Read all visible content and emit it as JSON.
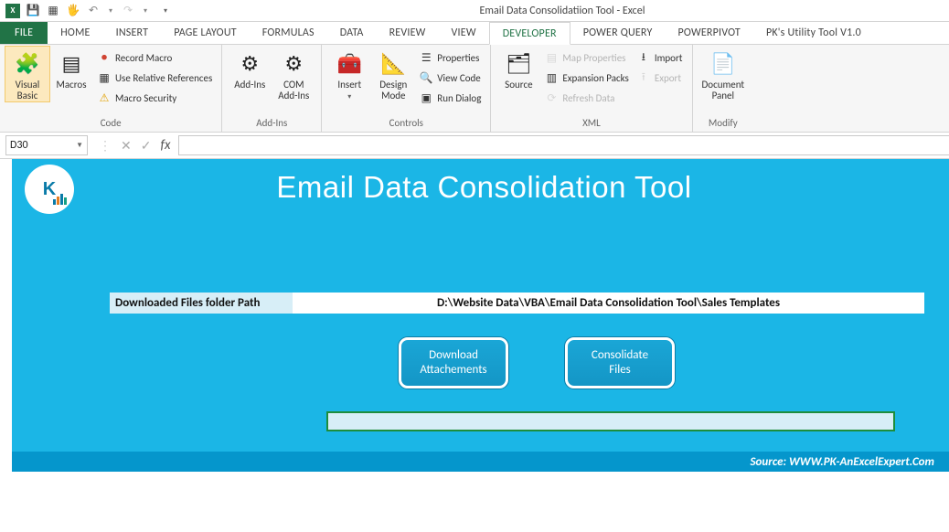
{
  "titlebar": {
    "title": "Email Data Consolidatiion Tool - Excel"
  },
  "qat": {
    "undo_glyph": "↶",
    "redo_glyph": "↷",
    "more_glyph": "▾"
  },
  "tabs": {
    "file": "FILE",
    "items": [
      "HOME",
      "INSERT",
      "PAGE LAYOUT",
      "FORMULAS",
      "DATA",
      "REVIEW",
      "VIEW",
      "DEVELOPER",
      "POWER QUERY",
      "POWERPIVOT",
      "PK's Utility Tool V1.0"
    ],
    "active": "DEVELOPER"
  },
  "ribbon": {
    "code": {
      "label": "Code",
      "visual_basic": "Visual\nBasic",
      "macros": "Macros",
      "record_macro": "Record Macro",
      "use_relative": "Use Relative References",
      "macro_security": "Macro Security"
    },
    "addins": {
      "label": "Add-Ins",
      "addins": "Add-Ins",
      "com": "COM\nAdd-Ins"
    },
    "controls": {
      "label": "Controls",
      "insert": "Insert",
      "design": "Design\nMode",
      "properties": "Properties",
      "view_code": "View Code",
      "run_dialog": "Run Dialog"
    },
    "xml": {
      "label": "XML",
      "source": "Source",
      "map_props": "Map Properties",
      "expansion": "Expansion Packs",
      "refresh": "Refresh Data",
      "import": "Import",
      "export": "Export"
    },
    "modify": {
      "label": "Modify",
      "doc_panel": "Document\nPanel"
    }
  },
  "fbar": {
    "name": "D30",
    "fx": "fx"
  },
  "tool": {
    "title": "Email Data Consolidation Tool",
    "form_label": "Downloaded Files folder Path",
    "form_value": "D:\\Website Data\\VBA\\Email Data Consolidation Tool\\Sales Templates",
    "btn1_line1": "Download",
    "btn1_line2": "Attachements",
    "btn2_line1": "Consolidate",
    "btn2_line2": "Files",
    "source": "Source: WWW.PK-AnExcelExpert.Com"
  }
}
